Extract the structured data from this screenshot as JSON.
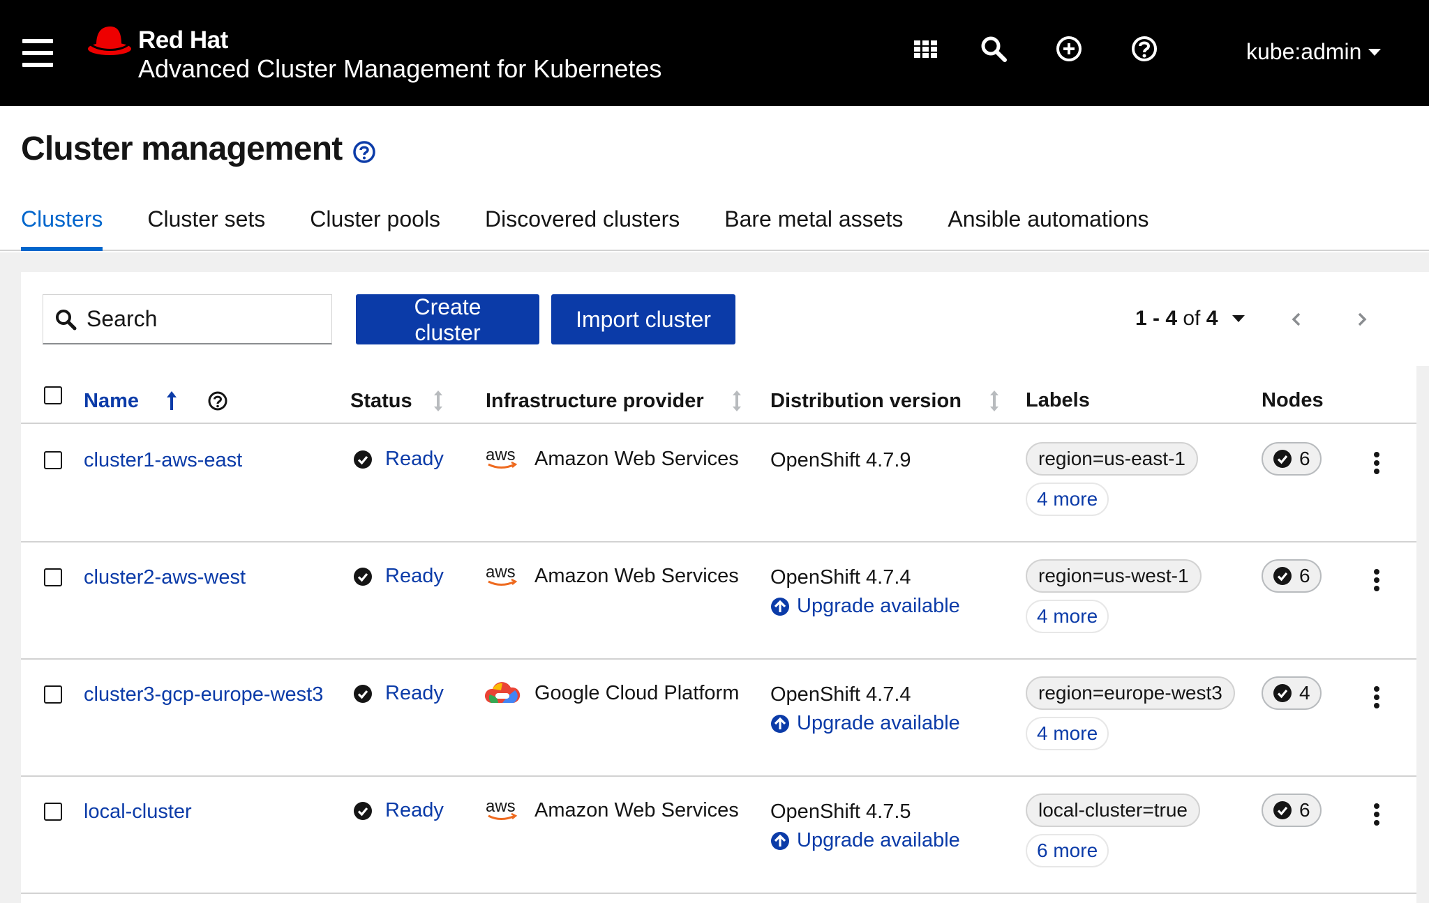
{
  "masthead": {
    "brand_top": "Red Hat",
    "brand_product": "Advanced Cluster Management for Kubernetes",
    "icons": [
      "apps-grid-icon",
      "search-icon",
      "plus-circle-icon",
      "help-icon"
    ],
    "user": "kube:admin"
  },
  "page": {
    "title": "Cluster management",
    "tabs": [
      {
        "label": "Clusters",
        "active": true
      },
      {
        "label": "Cluster sets",
        "active": false
      },
      {
        "label": "Cluster pools",
        "active": false
      },
      {
        "label": "Discovered clusters",
        "active": false
      },
      {
        "label": "Bare metal assets",
        "active": false
      },
      {
        "label": "Ansible automations",
        "active": false
      }
    ]
  },
  "toolbar": {
    "search_placeholder": "Search",
    "create_label": "Create cluster",
    "import_label": "Import cluster",
    "pagination_range": "1 - 4",
    "pagination_of": "of",
    "pagination_total": "4"
  },
  "table": {
    "headers": {
      "name": "Name",
      "status": "Status",
      "provider": "Infrastructure provider",
      "version": "Distribution version",
      "labels": "Labels",
      "nodes": "Nodes"
    },
    "rows": [
      {
        "name": "cluster1-aws-east",
        "status": "Ready",
        "provider": "Amazon Web Services",
        "provider_icon": "aws-logo-icon",
        "version": "OpenShift 4.7.9",
        "upgrade": "",
        "label": "region=us-east-1",
        "more": "4 more",
        "nodes": "6"
      },
      {
        "name": "cluster2-aws-west",
        "status": "Ready",
        "provider": "Amazon Web Services",
        "provider_icon": "aws-logo-icon",
        "version": "OpenShift 4.7.4",
        "upgrade": "Upgrade available",
        "label": "region=us-west-1",
        "more": "4 more",
        "nodes": "6"
      },
      {
        "name": "cluster3-gcp-europe-west3",
        "status": "Ready",
        "provider": "Google Cloud Platform",
        "provider_icon": "gcp-logo-icon",
        "version": "OpenShift 4.7.4",
        "upgrade": "Upgrade available",
        "label": "region=europe-west3",
        "more": "4 more",
        "nodes": "4"
      },
      {
        "name": "local-cluster",
        "status": "Ready",
        "provider": "Amazon Web Services",
        "provider_icon": "aws-logo-icon",
        "version": "OpenShift 4.7.5",
        "upgrade": "Upgrade available",
        "label": "local-cluster=true",
        "more": "6 more",
        "nodes": "6"
      }
    ]
  },
  "colors": {
    "masthead_bg": "#000000",
    "primary_blue": "#0b3ba8",
    "tab_active": "#0066cc",
    "redhat_red": "#ee0000"
  }
}
